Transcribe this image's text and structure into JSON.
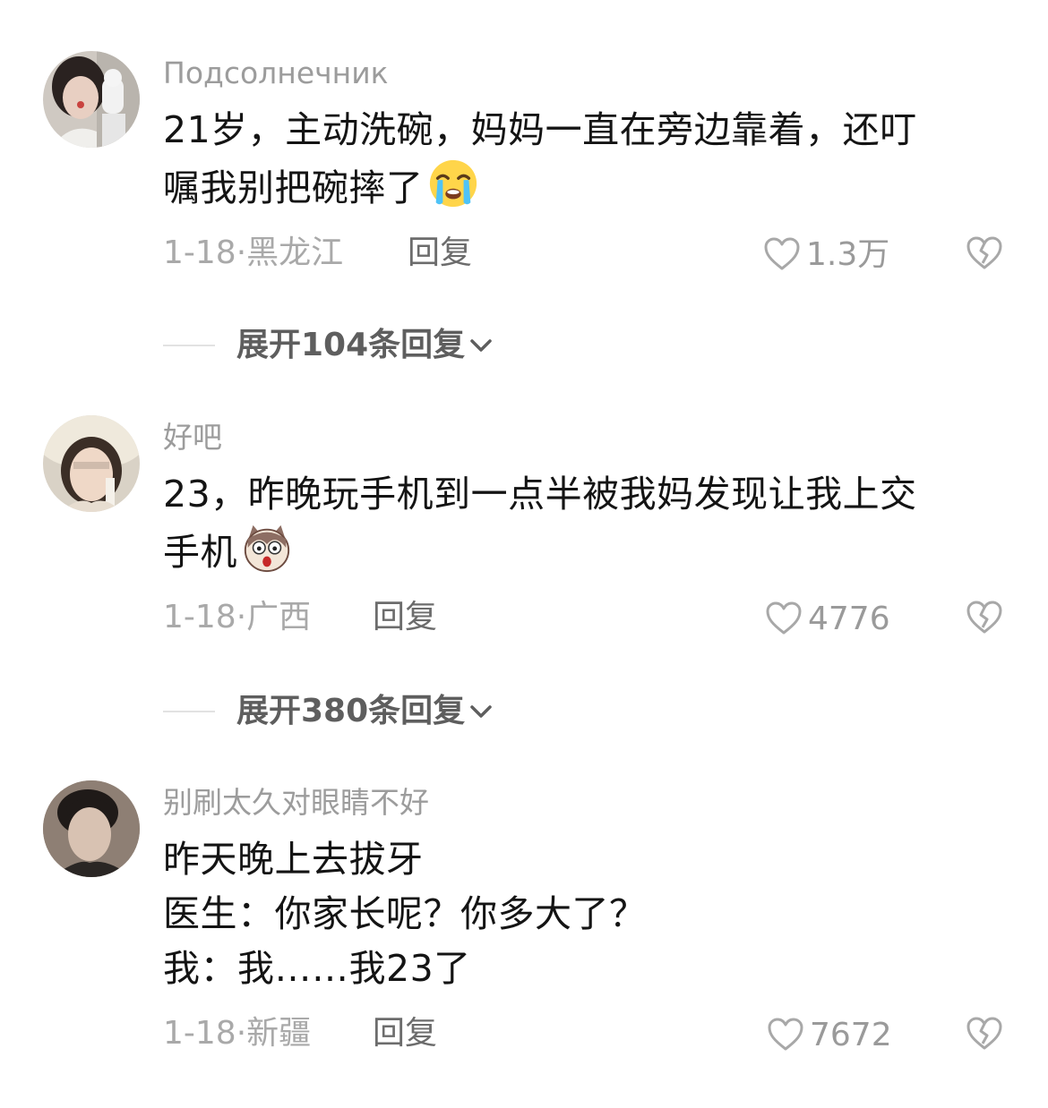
{
  "comments": [
    {
      "username": "Подсолнечник",
      "lines": [
        "21岁，主动洗碗，妈妈一直在旁边靠着，还叮",
        "嘱我别把碗摔了"
      ],
      "emoji": "crying-face",
      "date": "1-18",
      "location": "黑龙江",
      "reply_label": "回复",
      "likes": "1.3万",
      "expand_label": "展开104条回复"
    },
    {
      "username": "好吧",
      "lines": [
        "23，昨晚玩手机到一点半被我妈发现让我上交",
        "手机"
      ],
      "emoji": "shocked-dog",
      "date": "1-18",
      "location": "广西",
      "reply_label": "回复",
      "likes": "4776",
      "expand_label": "展开380条回复"
    },
    {
      "username": "别刷太久对眼睛不好",
      "lines": [
        "昨天晚上去拔牙",
        "医生：你家长呢？你多大了？",
        "我：我……我23了"
      ],
      "date": "1-18",
      "location": "新疆",
      "reply_label": "回复",
      "likes": "7672"
    }
  ],
  "meta_separator": "·",
  "icons": {
    "like": "heart-outline-icon",
    "dislike": "broken-heart-icon",
    "expand": "chevron-down-icon"
  },
  "colors": {
    "username": "#9c9c9c",
    "text": "#141414",
    "meta": "#a9a9a9",
    "reply": "#6c6c6c"
  }
}
